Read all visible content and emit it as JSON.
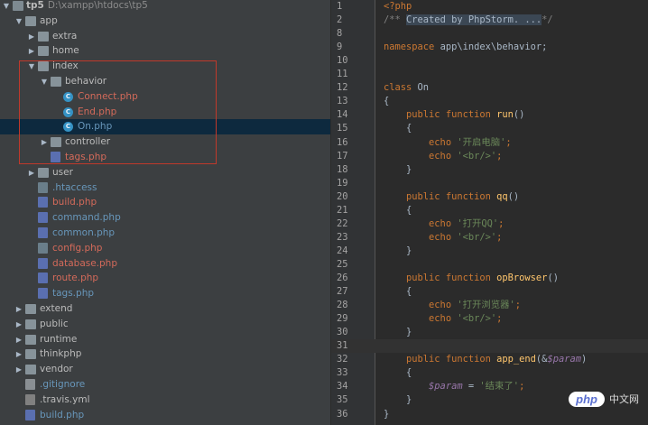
{
  "project_tree": {
    "root": {
      "name": "tp5",
      "path": "D:\\xampp\\htdocs\\tp5"
    },
    "items": [
      {
        "label": "app",
        "indent": 1,
        "kind": "folder",
        "arrow": "down",
        "style": "plain"
      },
      {
        "label": "extra",
        "indent": 2,
        "kind": "folder",
        "arrow": "right",
        "style": "plain"
      },
      {
        "label": "home",
        "indent": 2,
        "kind": "folder",
        "arrow": "right",
        "style": "plain"
      },
      {
        "label": "index",
        "indent": 2,
        "kind": "folder",
        "arrow": "down",
        "style": "plain"
      },
      {
        "label": "behavior",
        "indent": 3,
        "kind": "folder",
        "arrow": "down",
        "style": "plain"
      },
      {
        "label": "Connect.php",
        "indent": 4,
        "kind": "class",
        "style": "red"
      },
      {
        "label": "End.php",
        "indent": 4,
        "kind": "class",
        "style": "red"
      },
      {
        "label": "On.php",
        "indent": 4,
        "kind": "class",
        "style": "blue",
        "selected": true
      },
      {
        "label": "controller",
        "indent": 3,
        "kind": "folder",
        "arrow": "right",
        "style": "plain"
      },
      {
        "label": "tags.php",
        "indent": 3,
        "kind": "php",
        "style": "red"
      },
      {
        "label": "user",
        "indent": 2,
        "kind": "folder",
        "arrow": "right",
        "style": "plain"
      },
      {
        "label": ".htaccess",
        "indent": 2,
        "kind": "cfg",
        "style": "blue"
      },
      {
        "label": "build.php",
        "indent": 2,
        "kind": "php",
        "style": "red"
      },
      {
        "label": "command.php",
        "indent": 2,
        "kind": "php",
        "style": "blue"
      },
      {
        "label": "common.php",
        "indent": 2,
        "kind": "php",
        "style": "blue"
      },
      {
        "label": "config.php",
        "indent": 2,
        "kind": "cfg",
        "style": "red"
      },
      {
        "label": "database.php",
        "indent": 2,
        "kind": "php",
        "style": "red"
      },
      {
        "label": "route.php",
        "indent": 2,
        "kind": "php",
        "style": "red"
      },
      {
        "label": "tags.php",
        "indent": 2,
        "kind": "php",
        "style": "blue"
      },
      {
        "label": "extend",
        "indent": 1,
        "kind": "folder",
        "arrow": "right",
        "style": "plain"
      },
      {
        "label": "public",
        "indent": 1,
        "kind": "folder",
        "arrow": "right",
        "style": "plain"
      },
      {
        "label": "runtime",
        "indent": 1,
        "kind": "folder",
        "arrow": "right",
        "style": "plain"
      },
      {
        "label": "thinkphp",
        "indent": 1,
        "kind": "folder",
        "arrow": "right",
        "style": "plain"
      },
      {
        "label": "vendor",
        "indent": 1,
        "kind": "folder",
        "arrow": "right",
        "style": "plain"
      },
      {
        "label": ".gitignore",
        "indent": 1,
        "kind": "txt",
        "style": "blue"
      },
      {
        "label": ".travis.yml",
        "indent": 1,
        "kind": "yml",
        "style": "plain"
      },
      {
        "label": "build.php",
        "indent": 1,
        "kind": "php",
        "style": "blue"
      }
    ]
  },
  "editor": {
    "current_line": 31,
    "lines": [
      {
        "n": "1",
        "tokens": [
          {
            "t": "<?php",
            "c": "php-tag"
          }
        ]
      },
      {
        "n": "2",
        "tokens": [
          {
            "t": "/** ",
            "c": "cmt"
          },
          {
            "t": "Created by PhpStorm. ...",
            "c": "fold-text"
          },
          {
            "t": "*/",
            "c": "cmt"
          }
        ]
      },
      {
        "n": "8",
        "tokens": []
      },
      {
        "n": "9",
        "tokens": [
          {
            "t": "namespace ",
            "c": "kw"
          },
          {
            "t": "app\\index\\behavior;",
            "c": ""
          }
        ]
      },
      {
        "n": "10",
        "tokens": []
      },
      {
        "n": "11",
        "tokens": []
      },
      {
        "n": "12",
        "tokens": [
          {
            "t": "class ",
            "c": "kw"
          },
          {
            "t": "On",
            "c": ""
          }
        ]
      },
      {
        "n": "13",
        "tokens": [
          {
            "t": "{",
            "c": ""
          }
        ]
      },
      {
        "n": "14",
        "tokens": [
          {
            "t": "    public function ",
            "c": "kw"
          },
          {
            "t": "run",
            "c": "fn"
          },
          {
            "t": "()",
            "c": ""
          }
        ]
      },
      {
        "n": "15",
        "tokens": [
          {
            "t": "    {",
            "c": ""
          }
        ]
      },
      {
        "n": "16",
        "tokens": [
          {
            "t": "        echo ",
            "c": "kw"
          },
          {
            "t": "'开启电脑'",
            "c": "str"
          },
          {
            "t": ";",
            "c": "kw"
          }
        ]
      },
      {
        "n": "17",
        "tokens": [
          {
            "t": "        echo ",
            "c": "kw"
          },
          {
            "t": "'<br/>'",
            "c": "str"
          },
          {
            "t": ";",
            "c": "kw"
          }
        ]
      },
      {
        "n": "18",
        "tokens": [
          {
            "t": "    }",
            "c": ""
          }
        ]
      },
      {
        "n": "19",
        "tokens": []
      },
      {
        "n": "20",
        "tokens": [
          {
            "t": "    public function ",
            "c": "kw"
          },
          {
            "t": "qq",
            "c": "fn"
          },
          {
            "t": "()",
            "c": ""
          }
        ]
      },
      {
        "n": "21",
        "tokens": [
          {
            "t": "    {",
            "c": ""
          }
        ]
      },
      {
        "n": "22",
        "tokens": [
          {
            "t": "        echo ",
            "c": "kw"
          },
          {
            "t": "'打开QQ'",
            "c": "str"
          },
          {
            "t": ";",
            "c": "kw"
          }
        ]
      },
      {
        "n": "23",
        "tokens": [
          {
            "t": "        echo ",
            "c": "kw"
          },
          {
            "t": "'<br/>'",
            "c": "str"
          },
          {
            "t": ";",
            "c": "kw"
          }
        ]
      },
      {
        "n": "24",
        "tokens": [
          {
            "t": "    }",
            "c": ""
          }
        ]
      },
      {
        "n": "25",
        "tokens": []
      },
      {
        "n": "26",
        "tokens": [
          {
            "t": "    public function ",
            "c": "kw"
          },
          {
            "t": "opBrowser",
            "c": "fn"
          },
          {
            "t": "()",
            "c": ""
          }
        ]
      },
      {
        "n": "27",
        "tokens": [
          {
            "t": "    {",
            "c": ""
          }
        ]
      },
      {
        "n": "28",
        "tokens": [
          {
            "t": "        echo ",
            "c": "kw"
          },
          {
            "t": "'打开浏览器'",
            "c": "str"
          },
          {
            "t": ";",
            "c": "kw"
          }
        ]
      },
      {
        "n": "29",
        "tokens": [
          {
            "t": "        echo ",
            "c": "kw"
          },
          {
            "t": "'<br/>'",
            "c": "str"
          },
          {
            "t": ";",
            "c": "kw"
          }
        ]
      },
      {
        "n": "30",
        "tokens": [
          {
            "t": "    }",
            "c": ""
          }
        ]
      },
      {
        "n": "31",
        "tokens": []
      },
      {
        "n": "32",
        "tokens": [
          {
            "t": "    public function ",
            "c": "kw"
          },
          {
            "t": "app_end",
            "c": "fn"
          },
          {
            "t": "(&",
            "c": ""
          },
          {
            "t": "$param",
            "c": "var"
          },
          {
            "t": ")",
            "c": ""
          }
        ]
      },
      {
        "n": "33",
        "tokens": [
          {
            "t": "    {",
            "c": ""
          }
        ]
      },
      {
        "n": "34",
        "tokens": [
          {
            "t": "        ",
            "c": ""
          },
          {
            "t": "$param",
            "c": "var"
          },
          {
            "t": " = ",
            "c": ""
          },
          {
            "t": "'结束了'",
            "c": "str"
          },
          {
            "t": ";",
            "c": "kw"
          }
        ]
      },
      {
        "n": "35",
        "tokens": [
          {
            "t": "    }",
            "c": ""
          }
        ]
      },
      {
        "n": "36",
        "tokens": [
          {
            "t": "}",
            "c": ""
          }
        ]
      }
    ]
  },
  "watermark": {
    "badge": "php",
    "text": "中文网"
  },
  "colors": {
    "keyword": "#cc7832",
    "function": "#ffc66d",
    "string": "#6a8759",
    "variable": "#9876aa",
    "vcs_modified": "#6897bb",
    "vcs_unversioned": "#d46a5a"
  }
}
